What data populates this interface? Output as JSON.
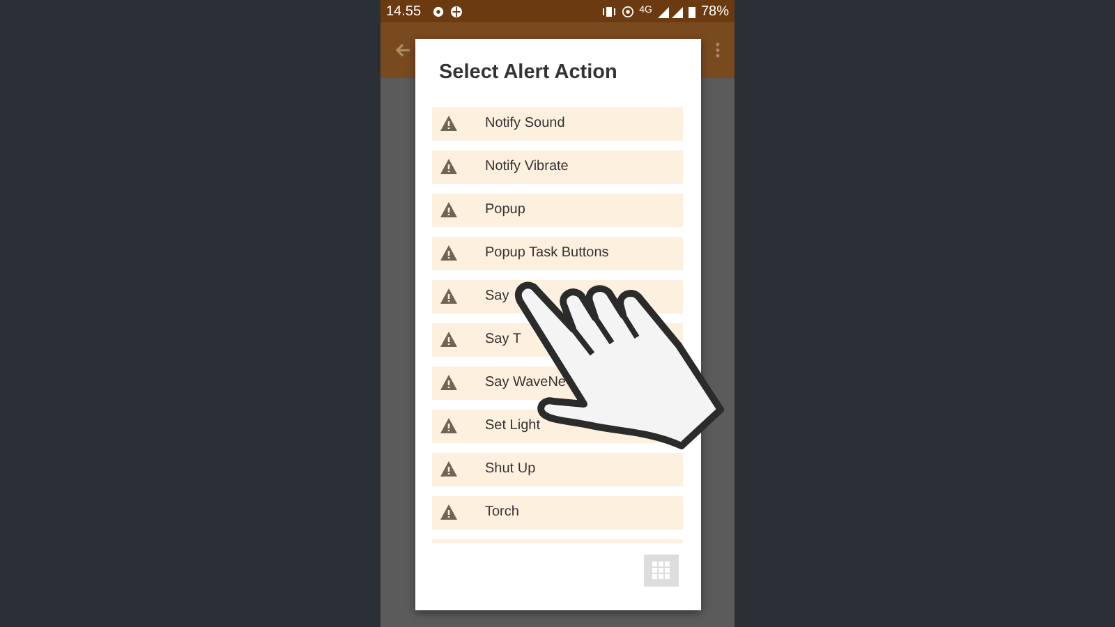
{
  "status_bar": {
    "time": "14.55",
    "network": "4G",
    "battery": "78%"
  },
  "dialog": {
    "title": "Select Alert Action",
    "items": [
      {
        "label": "Notify Sound"
      },
      {
        "label": "Notify Vibrate"
      },
      {
        "label": "Popup"
      },
      {
        "label": "Popup Task Buttons"
      },
      {
        "label": "Say"
      },
      {
        "label": "Say T"
      },
      {
        "label": "Say WaveNe"
      },
      {
        "label": "Set Light"
      },
      {
        "label": "Shut Up"
      },
      {
        "label": "Torch"
      }
    ]
  }
}
